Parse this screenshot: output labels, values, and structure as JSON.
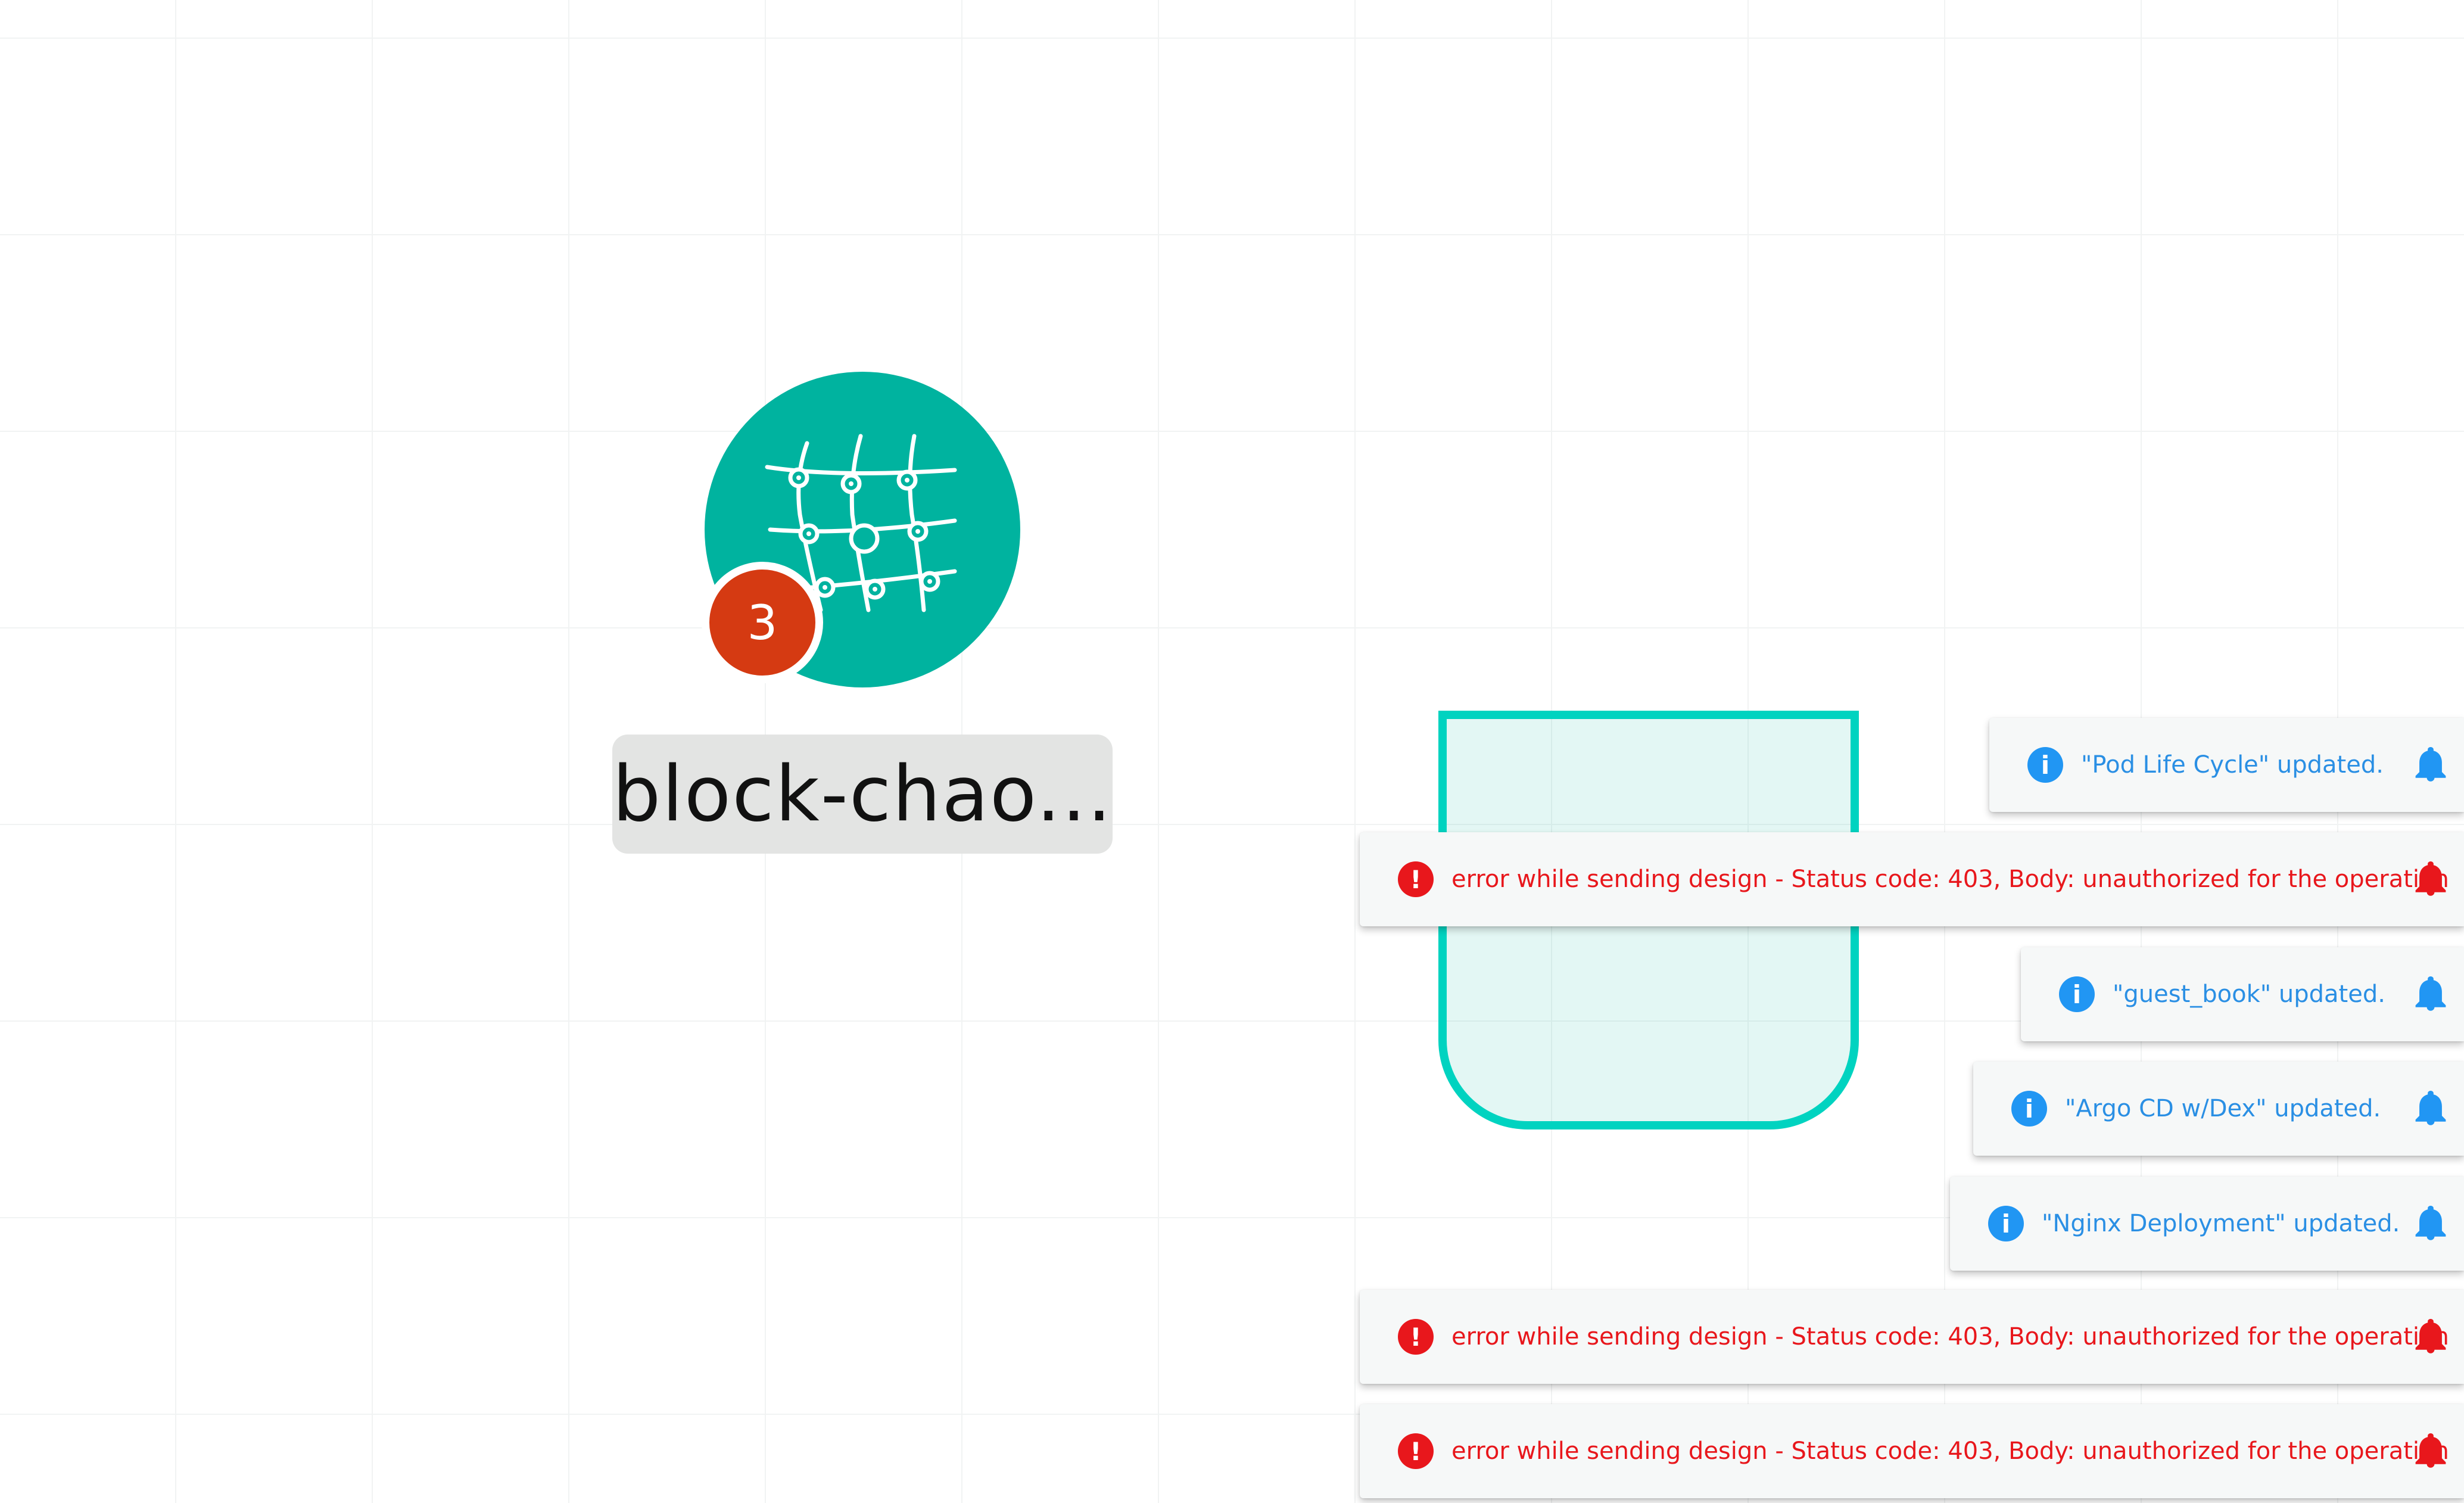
{
  "node": {
    "label": "block-chao...",
    "badge_count": "3",
    "icon": "chaos-mesh-grid-icon",
    "color": "#00b39f",
    "badge_color": "#d53a12"
  },
  "group_shape": {
    "border_color": "#00d3c0"
  },
  "notifications": [
    {
      "type": "info",
      "icon": "info-icon",
      "message": "\"Pod Life Cycle\" updated."
    },
    {
      "type": "error",
      "icon": "error-icon",
      "message": "error while sending design - Status code: 403, Body: unauthorized for the operation"
    },
    {
      "type": "info",
      "icon": "info-icon",
      "message": "\"guest_book\" updated."
    },
    {
      "type": "info",
      "icon": "info-icon",
      "message": "\"Argo CD w/Dex\" updated."
    },
    {
      "type": "info",
      "icon": "info-icon",
      "message": "\"Nginx Deployment\" updated."
    },
    {
      "type": "error",
      "icon": "error-icon",
      "message": "error while sending design - Status code: 403, Body: unauthorized for the operation"
    },
    {
      "type": "error",
      "icon": "error-icon",
      "message": "error while sending design - Status code: 403, Body: unauthorized for the operation"
    }
  ],
  "colors": {
    "info": "#2196f3",
    "error": "#e8171c"
  }
}
